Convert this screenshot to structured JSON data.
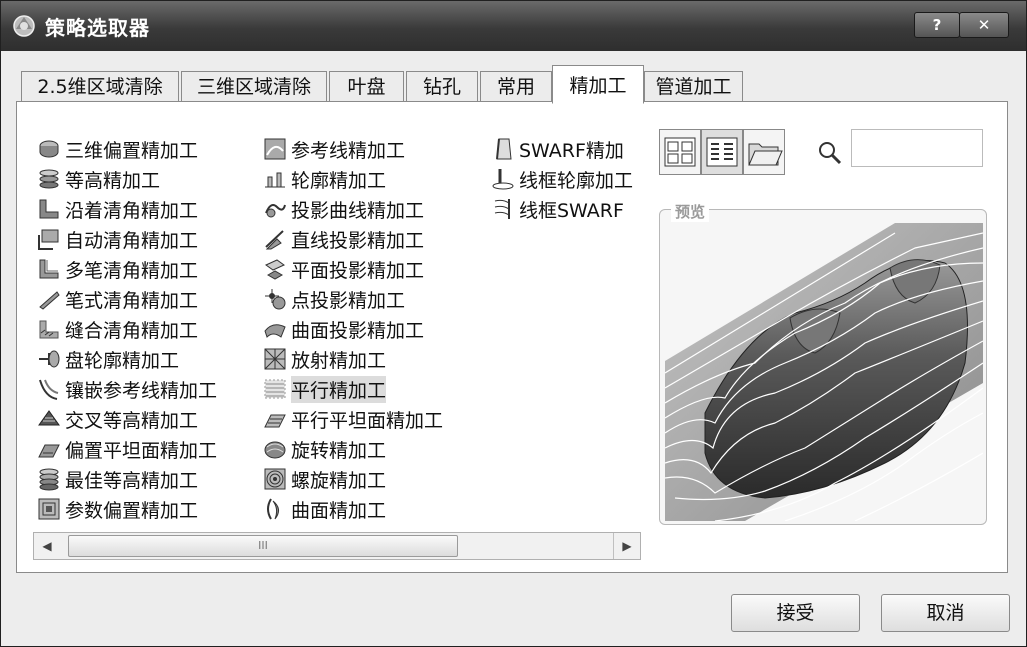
{
  "window": {
    "title": "策略选取器",
    "help_label": "?",
    "close_label": "✕"
  },
  "tabs": [
    {
      "label": "2.5维区域清除"
    },
    {
      "label": "三维区域清除"
    },
    {
      "label": "叶盘"
    },
    {
      "label": "钻孔"
    },
    {
      "label": "常用"
    },
    {
      "label": "精加工",
      "active": true
    },
    {
      "label": "管道加工"
    }
  ],
  "strategies": {
    "col1": [
      {
        "label": "三维偏置精加工",
        "icon": "offset-3d-icon"
      },
      {
        "label": "等高精加工",
        "icon": "constant-z-icon"
      },
      {
        "label": "沿着清角精加工",
        "icon": "along-corner-icon"
      },
      {
        "label": "自动清角精加工",
        "icon": "auto-corner-icon"
      },
      {
        "label": "多笔清角精加工",
        "icon": "multi-pencil-icon"
      },
      {
        "label": "笔式清角精加工",
        "icon": "pencil-corner-icon"
      },
      {
        "label": "缝合清角精加工",
        "icon": "stitch-corner-icon"
      },
      {
        "label": "盘轮廓精加工",
        "icon": "disc-profile-icon"
      },
      {
        "label": "镶嵌参考线精加工",
        "icon": "embedded-pattern-icon"
      },
      {
        "label": "交叉等高精加工",
        "icon": "cross-constant-z-icon"
      },
      {
        "label": "偏置平坦面精加工",
        "icon": "offset-flat-icon"
      },
      {
        "label": "最佳等高精加工",
        "icon": "optimised-constant-z-icon"
      },
      {
        "label": "参数偏置精加工",
        "icon": "parametric-offset-icon"
      }
    ],
    "col2": [
      {
        "label": "参考线精加工",
        "icon": "pattern-icon"
      },
      {
        "label": "轮廓精加工",
        "icon": "profile-icon"
      },
      {
        "label": "投影曲线精加工",
        "icon": "projection-curve-icon"
      },
      {
        "label": "直线投影精加工",
        "icon": "projection-line-icon"
      },
      {
        "label": "平面投影精加工",
        "icon": "projection-plane-icon"
      },
      {
        "label": "点投影精加工",
        "icon": "projection-point-icon"
      },
      {
        "label": "曲面投影精加工",
        "icon": "projection-surface-icon"
      },
      {
        "label": "放射精加工",
        "icon": "radial-icon"
      },
      {
        "label": "平行精加工",
        "icon": "raster-icon",
        "selected": true
      },
      {
        "label": "平行平坦面精加工",
        "icon": "raster-flat-icon"
      },
      {
        "label": "旋转精加工",
        "icon": "rotary-icon"
      },
      {
        "label": "螺旋精加工",
        "icon": "spiral-icon"
      },
      {
        "label": "曲面精加工",
        "icon": "surface-icon"
      }
    ],
    "col3": [
      {
        "label": "SWARF精加",
        "icon": "swarf-icon"
      },
      {
        "label": "线框轮廓加工",
        "icon": "wireframe-profile-icon"
      },
      {
        "label": "线框SWARF",
        "icon": "wireframe-swarf-icon"
      }
    ]
  },
  "scrollbar": {
    "thumb_label": "III"
  },
  "preview": {
    "legend": "预览"
  },
  "search": {
    "placeholder": ""
  },
  "buttons": {
    "accept": "接受",
    "cancel": "取消"
  }
}
